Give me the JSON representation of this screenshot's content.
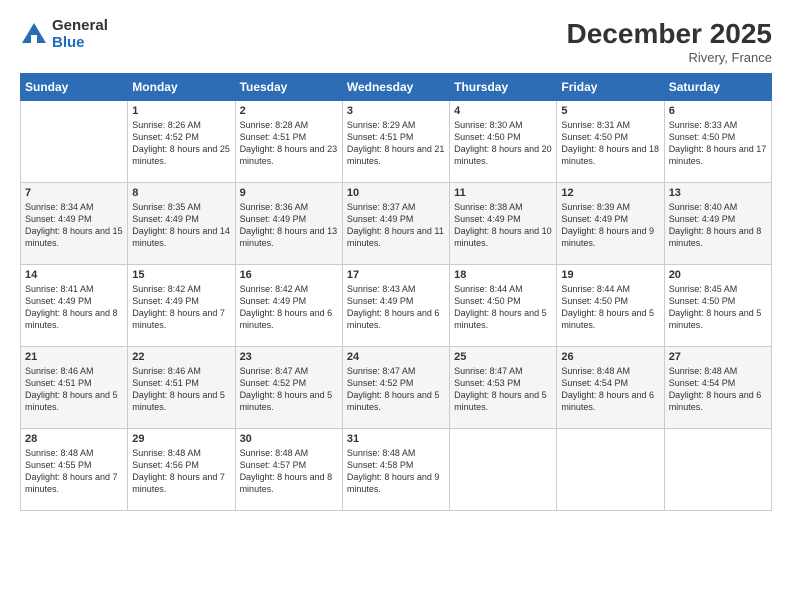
{
  "header": {
    "logo_general": "General",
    "logo_blue": "Blue",
    "month_title": "December 2025",
    "location": "Rivery, France"
  },
  "days_of_week": [
    "Sunday",
    "Monday",
    "Tuesday",
    "Wednesday",
    "Thursday",
    "Friday",
    "Saturday"
  ],
  "weeks": [
    [
      {
        "day": "",
        "sunrise": "",
        "sunset": "",
        "daylight": ""
      },
      {
        "day": "1",
        "sunrise": "Sunrise: 8:26 AM",
        "sunset": "Sunset: 4:52 PM",
        "daylight": "Daylight: 8 hours and 25 minutes."
      },
      {
        "day": "2",
        "sunrise": "Sunrise: 8:28 AM",
        "sunset": "Sunset: 4:51 PM",
        "daylight": "Daylight: 8 hours and 23 minutes."
      },
      {
        "day": "3",
        "sunrise": "Sunrise: 8:29 AM",
        "sunset": "Sunset: 4:51 PM",
        "daylight": "Daylight: 8 hours and 21 minutes."
      },
      {
        "day": "4",
        "sunrise": "Sunrise: 8:30 AM",
        "sunset": "Sunset: 4:50 PM",
        "daylight": "Daylight: 8 hours and 20 minutes."
      },
      {
        "day": "5",
        "sunrise": "Sunrise: 8:31 AM",
        "sunset": "Sunset: 4:50 PM",
        "daylight": "Daylight: 8 hours and 18 minutes."
      },
      {
        "day": "6",
        "sunrise": "Sunrise: 8:33 AM",
        "sunset": "Sunset: 4:50 PM",
        "daylight": "Daylight: 8 hours and 17 minutes."
      }
    ],
    [
      {
        "day": "7",
        "sunrise": "Sunrise: 8:34 AM",
        "sunset": "Sunset: 4:49 PM",
        "daylight": "Daylight: 8 hours and 15 minutes."
      },
      {
        "day": "8",
        "sunrise": "Sunrise: 8:35 AM",
        "sunset": "Sunset: 4:49 PM",
        "daylight": "Daylight: 8 hours and 14 minutes."
      },
      {
        "day": "9",
        "sunrise": "Sunrise: 8:36 AM",
        "sunset": "Sunset: 4:49 PM",
        "daylight": "Daylight: 8 hours and 13 minutes."
      },
      {
        "day": "10",
        "sunrise": "Sunrise: 8:37 AM",
        "sunset": "Sunset: 4:49 PM",
        "daylight": "Daylight: 8 hours and 11 minutes."
      },
      {
        "day": "11",
        "sunrise": "Sunrise: 8:38 AM",
        "sunset": "Sunset: 4:49 PM",
        "daylight": "Daylight: 8 hours and 10 minutes."
      },
      {
        "day": "12",
        "sunrise": "Sunrise: 8:39 AM",
        "sunset": "Sunset: 4:49 PM",
        "daylight": "Daylight: 8 hours and 9 minutes."
      },
      {
        "day": "13",
        "sunrise": "Sunrise: 8:40 AM",
        "sunset": "Sunset: 4:49 PM",
        "daylight": "Daylight: 8 hours and 8 minutes."
      }
    ],
    [
      {
        "day": "14",
        "sunrise": "Sunrise: 8:41 AM",
        "sunset": "Sunset: 4:49 PM",
        "daylight": "Daylight: 8 hours and 8 minutes."
      },
      {
        "day": "15",
        "sunrise": "Sunrise: 8:42 AM",
        "sunset": "Sunset: 4:49 PM",
        "daylight": "Daylight: 8 hours and 7 minutes."
      },
      {
        "day": "16",
        "sunrise": "Sunrise: 8:42 AM",
        "sunset": "Sunset: 4:49 PM",
        "daylight": "Daylight: 8 hours and 6 minutes."
      },
      {
        "day": "17",
        "sunrise": "Sunrise: 8:43 AM",
        "sunset": "Sunset: 4:49 PM",
        "daylight": "Daylight: 8 hours and 6 minutes."
      },
      {
        "day": "18",
        "sunrise": "Sunrise: 8:44 AM",
        "sunset": "Sunset: 4:50 PM",
        "daylight": "Daylight: 8 hours and 5 minutes."
      },
      {
        "day": "19",
        "sunrise": "Sunrise: 8:44 AM",
        "sunset": "Sunset: 4:50 PM",
        "daylight": "Daylight: 8 hours and 5 minutes."
      },
      {
        "day": "20",
        "sunrise": "Sunrise: 8:45 AM",
        "sunset": "Sunset: 4:50 PM",
        "daylight": "Daylight: 8 hours and 5 minutes."
      }
    ],
    [
      {
        "day": "21",
        "sunrise": "Sunrise: 8:46 AM",
        "sunset": "Sunset: 4:51 PM",
        "daylight": "Daylight: 8 hours and 5 minutes."
      },
      {
        "day": "22",
        "sunrise": "Sunrise: 8:46 AM",
        "sunset": "Sunset: 4:51 PM",
        "daylight": "Daylight: 8 hours and 5 minutes."
      },
      {
        "day": "23",
        "sunrise": "Sunrise: 8:47 AM",
        "sunset": "Sunset: 4:52 PM",
        "daylight": "Daylight: 8 hours and 5 minutes."
      },
      {
        "day": "24",
        "sunrise": "Sunrise: 8:47 AM",
        "sunset": "Sunset: 4:52 PM",
        "daylight": "Daylight: 8 hours and 5 minutes."
      },
      {
        "day": "25",
        "sunrise": "Sunrise: 8:47 AM",
        "sunset": "Sunset: 4:53 PM",
        "daylight": "Daylight: 8 hours and 5 minutes."
      },
      {
        "day": "26",
        "sunrise": "Sunrise: 8:48 AM",
        "sunset": "Sunset: 4:54 PM",
        "daylight": "Daylight: 8 hours and 6 minutes."
      },
      {
        "day": "27",
        "sunrise": "Sunrise: 8:48 AM",
        "sunset": "Sunset: 4:54 PM",
        "daylight": "Daylight: 8 hours and 6 minutes."
      }
    ],
    [
      {
        "day": "28",
        "sunrise": "Sunrise: 8:48 AM",
        "sunset": "Sunset: 4:55 PM",
        "daylight": "Daylight: 8 hours and 7 minutes."
      },
      {
        "day": "29",
        "sunrise": "Sunrise: 8:48 AM",
        "sunset": "Sunset: 4:56 PM",
        "daylight": "Daylight: 8 hours and 7 minutes."
      },
      {
        "day": "30",
        "sunrise": "Sunrise: 8:48 AM",
        "sunset": "Sunset: 4:57 PM",
        "daylight": "Daylight: 8 hours and 8 minutes."
      },
      {
        "day": "31",
        "sunrise": "Sunrise: 8:48 AM",
        "sunset": "Sunset: 4:58 PM",
        "daylight": "Daylight: 8 hours and 9 minutes."
      },
      {
        "day": "",
        "sunrise": "",
        "sunset": "",
        "daylight": ""
      },
      {
        "day": "",
        "sunrise": "",
        "sunset": "",
        "daylight": ""
      },
      {
        "day": "",
        "sunrise": "",
        "sunset": "",
        "daylight": ""
      }
    ]
  ]
}
